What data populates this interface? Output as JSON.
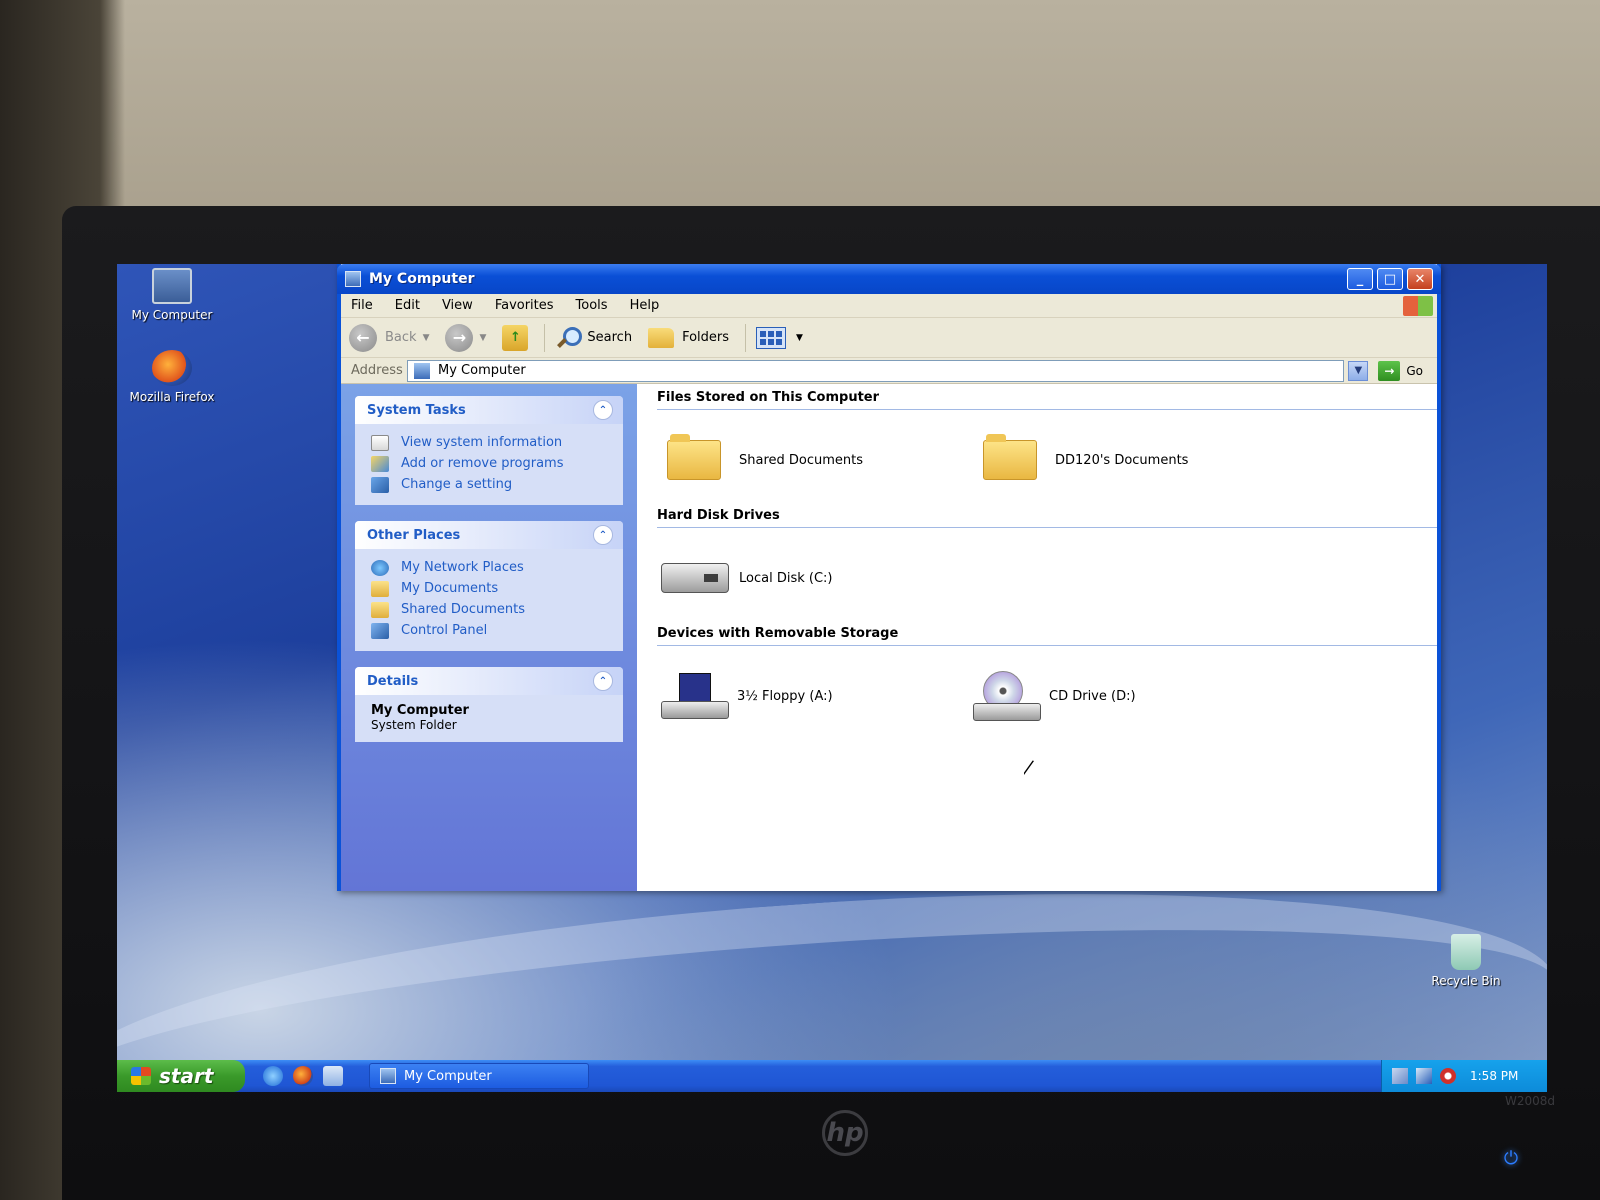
{
  "desktop": {
    "icons": [
      {
        "label": "My Computer"
      },
      {
        "label": "Mozilla Firefox"
      },
      {
        "label": "Recycle Bin"
      }
    ]
  },
  "window": {
    "title": "My Computer",
    "controls": {
      "minimize": "_",
      "maximize": "□",
      "close": "✕"
    },
    "menu": [
      "File",
      "Edit",
      "View",
      "Favorites",
      "Tools",
      "Help"
    ],
    "toolbar": {
      "back_label": "Back",
      "search_label": "Search",
      "folders_label": "Folders"
    },
    "address": {
      "label": "Address",
      "value": "My Computer",
      "go_label": "Go"
    }
  },
  "taskpane": {
    "system_tasks": {
      "title": "System Tasks",
      "items": [
        {
          "label": "View system information",
          "icon": "system-info-icon"
        },
        {
          "label": "Add or remove programs",
          "icon": "add-remove-programs-icon"
        },
        {
          "label": "Change a setting",
          "icon": "control-panel-icon"
        }
      ]
    },
    "other_places": {
      "title": "Other Places",
      "items": [
        {
          "label": "My Network Places",
          "icon": "network-icon"
        },
        {
          "label": "My Documents",
          "icon": "folder-icon"
        },
        {
          "label": "Shared Documents",
          "icon": "folder-icon"
        },
        {
          "label": "Control Panel",
          "icon": "control-panel-icon"
        }
      ]
    },
    "details": {
      "title": "Details",
      "name": "My Computer",
      "type": "System Folder"
    }
  },
  "content": {
    "groups": [
      {
        "heading": "Files Stored on This Computer",
        "items": [
          "Shared Documents",
          "DD120's Documents"
        ]
      },
      {
        "heading": "Hard Disk Drives",
        "items": [
          "Local Disk (C:)"
        ]
      },
      {
        "heading": "Devices with Removable Storage",
        "items": [
          "3½ Floppy (A:)",
          "CD Drive (D:)"
        ]
      }
    ]
  },
  "taskbar": {
    "start_label": "start",
    "task_label": "My Computer",
    "clock": "1:58 PM"
  },
  "monitor": {
    "brand": "hp",
    "model": "W2008d"
  }
}
